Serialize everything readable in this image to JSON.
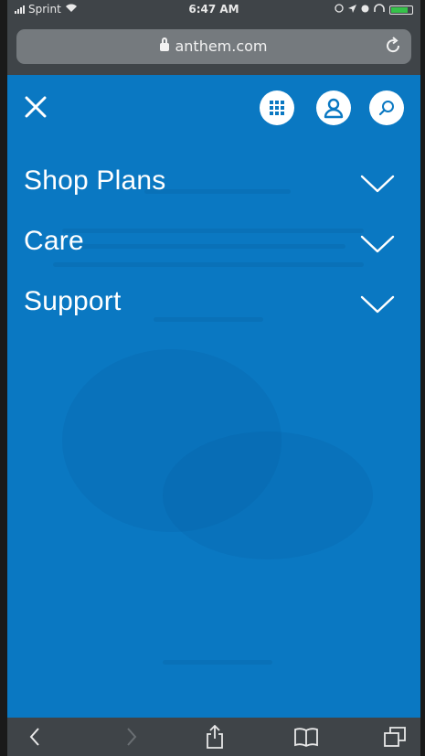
{
  "status_bar": {
    "carrier": "Sprint",
    "time": "6:47 AM"
  },
  "browser": {
    "url": "anthem.com"
  },
  "menu": {
    "items": [
      {
        "label": "Shop Plans"
      },
      {
        "label": "Care"
      },
      {
        "label": "Support"
      }
    ]
  },
  "icons": {
    "close": "close-icon",
    "grid": "apps-grid-icon",
    "account": "account-icon",
    "search": "search-icon",
    "chevron": "chevron-down-icon"
  },
  "colors": {
    "menu_background": "#0a78c2",
    "chrome": "#3f4448",
    "url_field": "#757a7e",
    "icon_button_bg": "#ffffff",
    "icon_fg": "#0a78c2"
  }
}
